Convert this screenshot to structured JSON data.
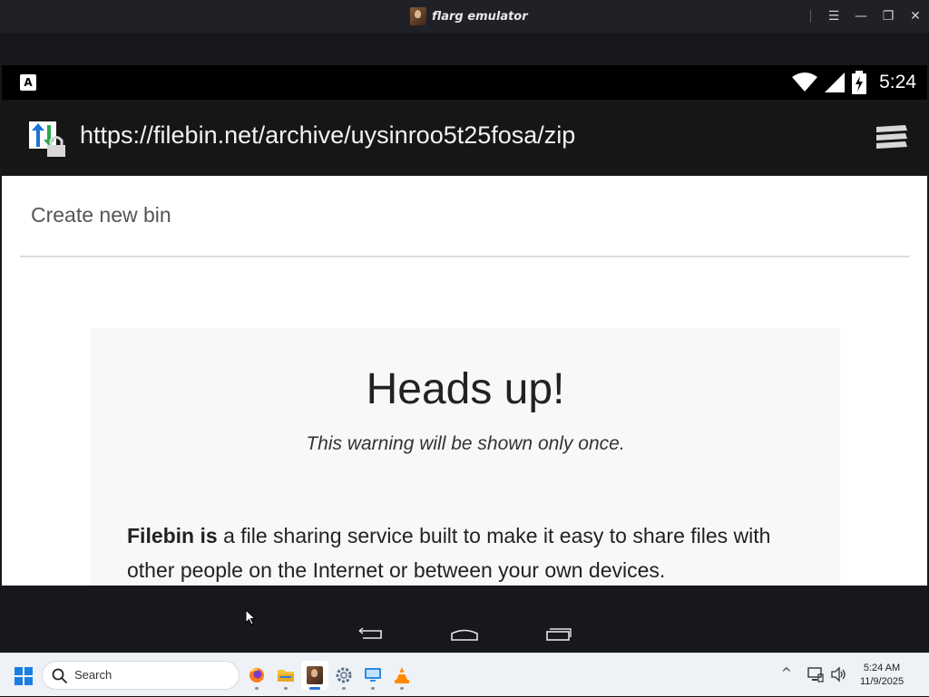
{
  "window": {
    "title": "flarg emulator",
    "controls": {
      "menu": "☰",
      "minimize": "—",
      "restore": "❐",
      "close": "✕"
    }
  },
  "status_bar": {
    "keyboard_indicator": "A",
    "time": "5:24",
    "icons": [
      "wifi-icon",
      "signal-icon",
      "battery-charging-icon"
    ]
  },
  "browser": {
    "url": "https://filebin.net/archive/uysinroo5t25fosa/zip",
    "site_icon": "download-lock-icon",
    "menu_icon": "stacked-menu-icon"
  },
  "page": {
    "create_link": "Create new bin",
    "card": {
      "heading": "Heads up!",
      "note": "This warning will be shown only once.",
      "para_bold": "Filebin is",
      "para_rest": " a file sharing service built to make it easy to share files with other people on the Internet or between your own devices."
    }
  },
  "nav_bar": {
    "buttons": [
      "back-icon",
      "home-icon",
      "recents-icon"
    ]
  },
  "taskbar": {
    "search_placeholder": "Search",
    "apps": [
      "firefox-icon",
      "file-explorer-icon",
      "flarg-emulator-icon",
      "settings-gear-icon",
      "remote-desktop-icon",
      "vlc-icon"
    ],
    "tray": {
      "chevron": "^",
      "time": "5:24 AM",
      "date": "11/9/2025"
    }
  },
  "colors": {
    "accent": "#2a6fd6",
    "window_bg": "#16181d",
    "url_bar_bg": "#161616",
    "card_bg": "#f8f8f8"
  }
}
